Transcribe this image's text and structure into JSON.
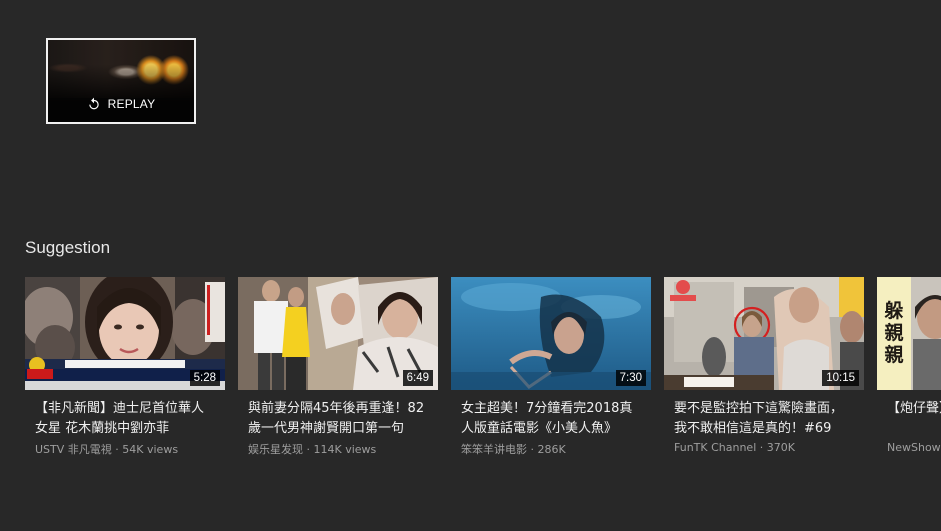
{
  "replay": {
    "label": "REPLAY",
    "icon": "replay-icon"
  },
  "suggestion": {
    "title": "Suggestion",
    "videos": [
      {
        "title": "【非凡新聞】迪士尼首位華人女星 花木蘭挑中劉亦菲",
        "channel": "USTV 非凡電視",
        "views": "54K views",
        "duration": "5:28"
      },
      {
        "title": "與前妻分隔45年後再重逢！82歲一代男神謝賢開口第一句",
        "channel": "娱乐星发现",
        "views": "114K views",
        "duration": "6:49"
      },
      {
        "title": "女主超美！7分鐘看完2018真人版童話電影《小美人魚》",
        "channel": "笨笨羊讲电影",
        "views": "286K",
        "duration": "7:30"
      },
      {
        "title": "要不是監控拍下這驚險畫面，我不敢相信這是真的！#69",
        "channel": "FunTK Channel",
        "views": "370K",
        "duration": "10:15"
      },
      {
        "title": "【炮仔聲】 生子！添",
        "channel": "NewShowBiz",
        "views": "",
        "duration": ""
      }
    ]
  },
  "thumb_text": {
    "v4_tag": "躲親親"
  }
}
